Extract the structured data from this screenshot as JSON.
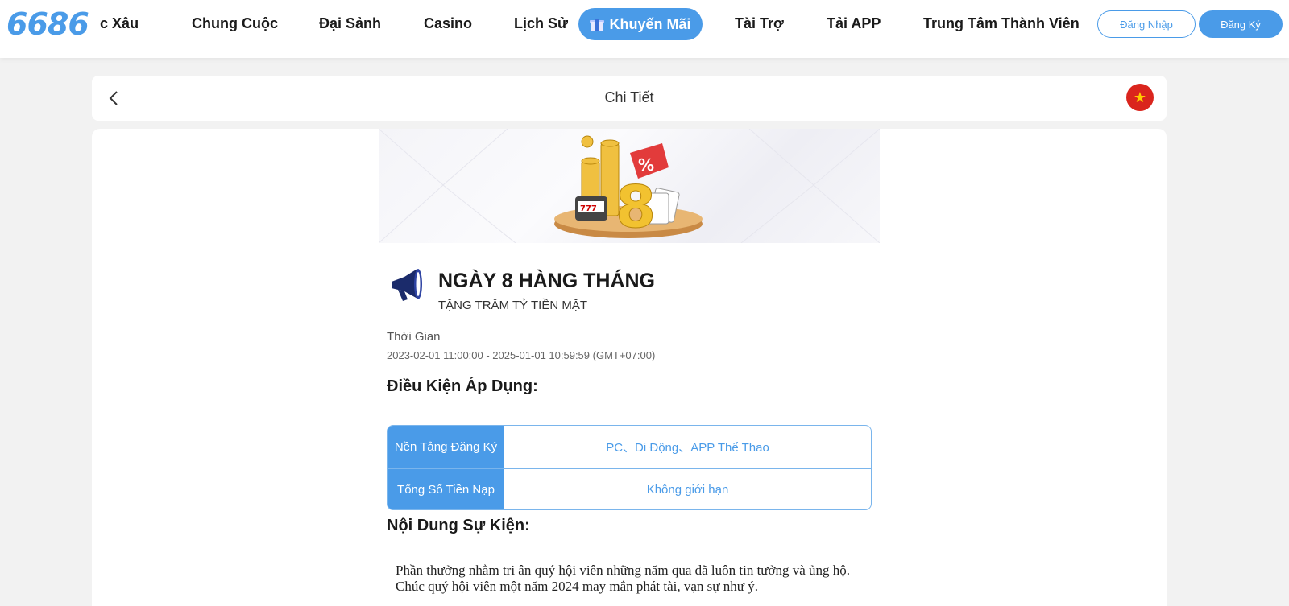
{
  "nav": {
    "logo": "6686",
    "clipped_item": "ực Xâu",
    "items": [
      "Chung Cuộc",
      "Đại Sảnh",
      "Casino",
      "Lịch Sử"
    ],
    "promo_label": "Khuyến Mãi",
    "right_items": [
      "Tài Trợ",
      "Tải APP",
      "Trung Tâm Thành Viên"
    ],
    "login_label": "Đăng Nhập",
    "register_label": "Đăng Ký",
    "accent_color": "#4a9be8"
  },
  "detail_bar": {
    "title": "Chi Tiết",
    "back_icon": "chevron-left-icon",
    "language_icon": "vietnam-flag-icon"
  },
  "promotion": {
    "banner_number": "8",
    "title": "NGÀY 8 HÀNG THÁNG",
    "subtitle": "TẶNG TRĂM TỶ TIỀN MẶT",
    "time_label": "Thời Gian",
    "time_value": "2023-02-01 11:00:00 - 2025-01-01 10:59:59 (GMT+07:00)",
    "conditions_heading": "Điều Kiện Áp Dụng:",
    "conditions": [
      {
        "key": "Nền Tảng Đăng Ký",
        "value": "PC、Di Động、APP Thể Thao"
      },
      {
        "key": "Tổng Số Tiền Nạp",
        "value": "Không giới hạn"
      }
    ],
    "content_heading": "Nội Dung Sự Kiện:",
    "content_text": "Phần thưởng nhằm tri ân quý hội viên những năm qua đã luôn tin tưởng và ủng hộ. Chúc quý hội viên một năm 2024 may mắn phát tài, vạn sự như ý."
  }
}
